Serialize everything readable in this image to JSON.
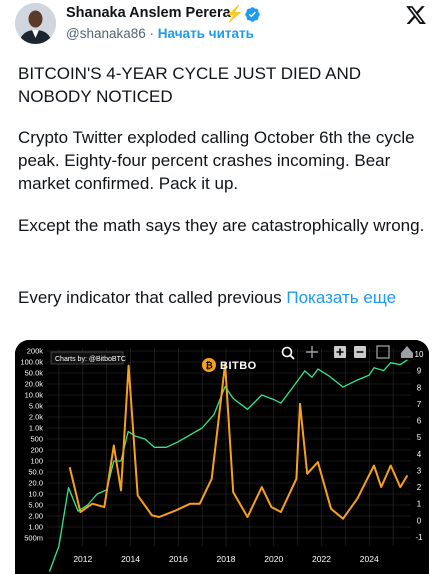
{
  "author": {
    "display_name": "Shanaka Anslem Perera",
    "badge_emoji": "⚡",
    "handle": "@shanaka86",
    "separator": "·",
    "follow_label": "Начать читать"
  },
  "tweet": {
    "headline": "BITCOIN'S 4-YEAR CYCLE JUST DIED AND NOBODY NOTICED",
    "paragraph_2": "Crypto Twitter exploded calling October 6th the cycle peak. Eighty-four percent crashes incoming. Bear market confirmed. Pack it up.",
    "paragraph_3": "Except the math says they are catastrophically wrong.",
    "paragraph_4": "Every indicator that called previous",
    "show_more": "Показать еще"
  },
  "chart_image": {
    "credit": "Charts by: @BitboBTC",
    "brand": "BITBO",
    "colors": {
      "background": "#000000",
      "orange": "#f7a11a",
      "green": "#2ee88a",
      "grid": "#333333"
    },
    "toolbar_icons": [
      "zoom-icon",
      "pan-icon",
      "zoom-in-icon",
      "zoom-out-icon",
      "fullscreen-icon",
      "home-icon"
    ]
  },
  "chart_data": {
    "type": "line",
    "title": "",
    "xlabel": "",
    "ylabel": "",
    "x_ticks": [
      "2012",
      "2014",
      "2016",
      "2018",
      "2020",
      "2022",
      "2024"
    ],
    "y_left_ticks": [
      "200k",
      "100.0k",
      "50.0k",
      "20.0k",
      "10.0k",
      "5.0k",
      "2.0k",
      "1.0k",
      "500",
      "200",
      "100",
      "50.0",
      "20.0",
      "10.0",
      "5.00",
      "2.00",
      "1.00",
      "500m"
    ],
    "y_left_scale": "log",
    "y_right_ticks": [
      "10",
      "9",
      "8",
      "7",
      "6",
      "5",
      "4",
      "3",
      "2",
      "1",
      "0",
      "-1"
    ],
    "grid": true,
    "series": [
      {
        "color": "#2ee88a",
        "axis": "left",
        "x": [
          2010.6,
          2011.0,
          2011.4,
          2011.8,
          2012.2,
          2012.6,
          2013.0,
          2013.3,
          2013.6,
          2013.9,
          2014.2,
          2014.6,
          2015.0,
          2015.5,
          2016.0,
          2016.5,
          2017.0,
          2017.5,
          2017.96,
          2018.3,
          2018.9,
          2019.5,
          2020.0,
          2020.3,
          2020.9,
          2021.3,
          2021.6,
          2021.85,
          2022.3,
          2022.9,
          2023.5,
          2024.0,
          2024.2,
          2024.6,
          2024.9,
          2025.3,
          2025.6
        ],
        "y": [
          0.06,
          0.3,
          15,
          3,
          5,
          10,
          13,
          100,
          100,
          800,
          600,
          500,
          250,
          250,
          400,
          650,
          1000,
          2500,
          17000,
          8000,
          3800,
          10000,
          7500,
          6000,
          20000,
          57000,
          35000,
          64000,
          40000,
          16500,
          28000,
          42000,
          70000,
          58000,
          95000,
          85000,
          115000
        ]
      },
      {
        "color": "#f7a11a",
        "axis": "right",
        "x": [
          2011.45,
          2011.9,
          2012.4,
          2012.9,
          2013.3,
          2013.6,
          2013.92,
          2014.3,
          2014.9,
          2015.2,
          2015.9,
          2016.5,
          2016.9,
          2017.4,
          2017.96,
          2018.3,
          2018.9,
          2019.5,
          2019.9,
          2020.3,
          2020.95,
          2021.1,
          2021.4,
          2021.85,
          2022.4,
          2022.9,
          2023.5,
          2024.2,
          2024.5,
          2024.9,
          2025.3,
          2025.6
        ],
        "y": [
          3.2,
          0.5,
          1.0,
          0.8,
          4.5,
          1.8,
          9.3,
          1.5,
          0.3,
          0.2,
          0.6,
          1.0,
          1.0,
          2.5,
          9.4,
          1.7,
          0.2,
          2.0,
          0.8,
          0.5,
          2.5,
          7.0,
          2.8,
          3.5,
          0.7,
          0.1,
          1.3,
          3.3,
          2.0,
          3.3,
          2.0,
          2.7
        ]
      }
    ]
  }
}
